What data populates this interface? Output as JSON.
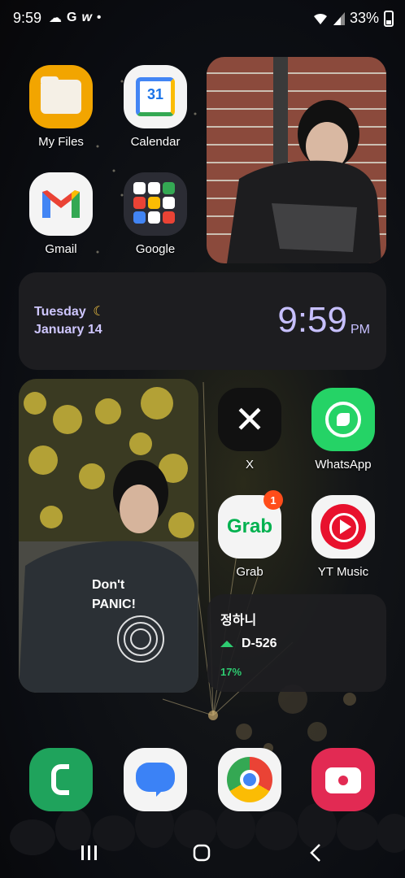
{
  "status_bar": {
    "time": "9:59",
    "notification_icons": [
      "cloud-icon",
      "google-g-icon",
      "w-app-icon",
      "dot-icon"
    ],
    "battery": "33%",
    "wifi_icon": "wifi-icon",
    "signal_icon": "signal-icon"
  },
  "apps_top": [
    {
      "label": "My Files",
      "icon": "folder-icon"
    },
    {
      "label": "Calendar",
      "icon": "google-calendar-icon",
      "calendar_day": "31"
    },
    {
      "label": "Gmail",
      "icon": "gmail-icon"
    },
    {
      "label": "Google",
      "icon": "google-folder-icon"
    }
  ],
  "clock_widget": {
    "day": "Tuesday",
    "date": "January 14",
    "time": "9:59",
    "ampm": "PM",
    "moon_icon": "moon-icon"
  },
  "apps_right": [
    {
      "label": "X",
      "icon": "x-icon"
    },
    {
      "label": "WhatsApp",
      "icon": "whatsapp-icon"
    },
    {
      "label": "Grab",
      "icon": "grab-icon",
      "badge": "1",
      "icon_text": "Grab"
    },
    {
      "label": "YT Music",
      "icon": "yt-music-icon"
    }
  ],
  "dday_widget": {
    "name": "정하니",
    "counter": "D-526",
    "percent": "17%"
  },
  "dock": [
    {
      "icon": "phone-icon"
    },
    {
      "icon": "messages-icon"
    },
    {
      "icon": "chrome-icon"
    },
    {
      "icon": "camera-icon"
    }
  ],
  "colors": {
    "clock_text": "#c7c0ff",
    "dday_accent": "#2ecc71",
    "badge": "#ff4d1a"
  }
}
